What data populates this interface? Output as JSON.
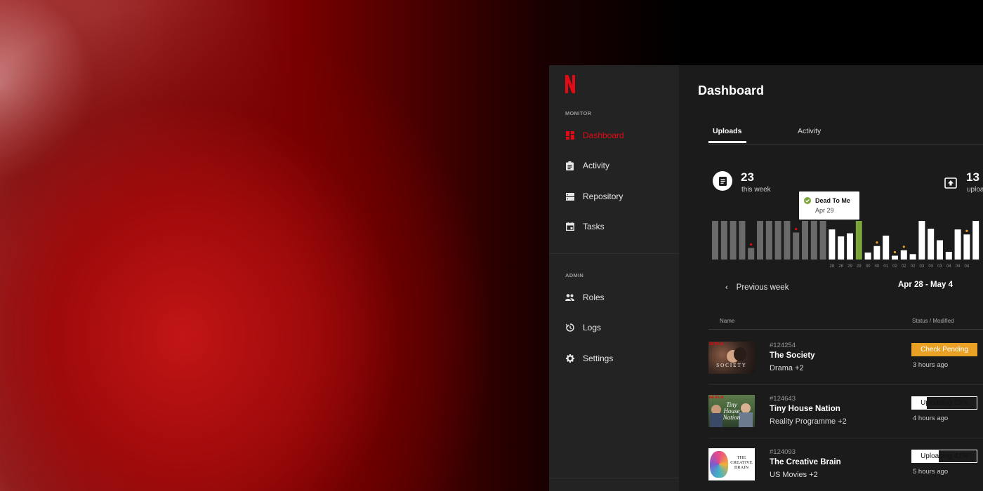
{
  "sidebar": {
    "monitor_label": "MONITOR",
    "admin_label": "ADMIN",
    "monitor_items": [
      {
        "label": "Dashboard",
        "icon": "dashboard-icon",
        "active": true
      },
      {
        "label": "Activity",
        "icon": "clipboard-icon",
        "active": false
      },
      {
        "label": "Repository",
        "icon": "storage-icon",
        "active": false
      },
      {
        "label": "Tasks",
        "icon": "calendar-icon",
        "active": false
      }
    ],
    "admin_items": [
      {
        "label": "Roles",
        "icon": "people-icon"
      },
      {
        "label": "Logs",
        "icon": "history-icon"
      },
      {
        "label": "Settings",
        "icon": "gear-icon"
      }
    ]
  },
  "header": {
    "title": "Dashboard"
  },
  "tabs": [
    {
      "label": "Uploads",
      "active": true
    },
    {
      "label": "Activity",
      "active": false
    }
  ],
  "stats": {
    "week_count": "23",
    "week_label": "this week",
    "uploads_count": "13",
    "uploads_label": "uploa"
  },
  "tooltip": {
    "title": "Dead To Me",
    "date": "Apr 29"
  },
  "chart_data": {
    "type": "bar",
    "x_labels": [
      "28",
      "28",
      "29",
      "29",
      "30",
      "30",
      "01",
      "02",
      "02",
      "02",
      "03",
      "03",
      "03",
      "04",
      "04",
      "04"
    ],
    "past_bars": [
      1,
      1,
      1,
      1,
      0.3,
      1,
      1,
      1,
      1,
      0.7,
      1,
      1,
      1
    ],
    "past_markers": [
      4,
      9
    ],
    "current_bars": [
      0.78,
      0.6,
      0.68,
      1,
      0.18,
      0.35,
      0.62,
      0.1,
      0.24,
      0.14,
      1,
      0.8,
      0.5,
      0.2,
      0.78,
      0.65,
      1
    ],
    "highlight_index": 3,
    "current_markers": [
      5,
      7,
      8,
      10,
      15
    ],
    "colors": {
      "past": "#6a6a6a",
      "current": "#ffffff",
      "highlight": "#7aa53b",
      "marker_red": "#e50914",
      "marker_orange": "#e8a124"
    }
  },
  "week_nav": {
    "previous": "Previous week",
    "range": "Apr 28 - May 4"
  },
  "table": {
    "col_name": "Name",
    "col_status": "Status / Modified",
    "rows": [
      {
        "id": "#124254",
        "title": "The Society",
        "genre": "Drama  +2",
        "status": "Check Pending",
        "status_type": "pending",
        "progress": null,
        "time": "3 hours ago",
        "thumb_text": "SOCIETY"
      },
      {
        "id": "#124643",
        "title": "Tiny House Nation",
        "genre": "Reality Programme  +2",
        "status": "Uploading 23%",
        "status_type": "uploading",
        "progress": 0.23,
        "time": "4 hours ago",
        "thumb_text": "Tiny House Nation"
      },
      {
        "id": "#124093",
        "title": "The Creative Brain",
        "genre": "US Movies  +2",
        "status": "Uploading 41%",
        "status_type": "uploading",
        "progress": 0.41,
        "time": "5 hours ago",
        "thumb_text": "THE CREATIVE BRAIN"
      }
    ]
  },
  "colors": {
    "brand": "#e50914",
    "pending": "#e8a124",
    "sidebar_bg": "#232323",
    "main_bg": "#1b1b1b"
  }
}
